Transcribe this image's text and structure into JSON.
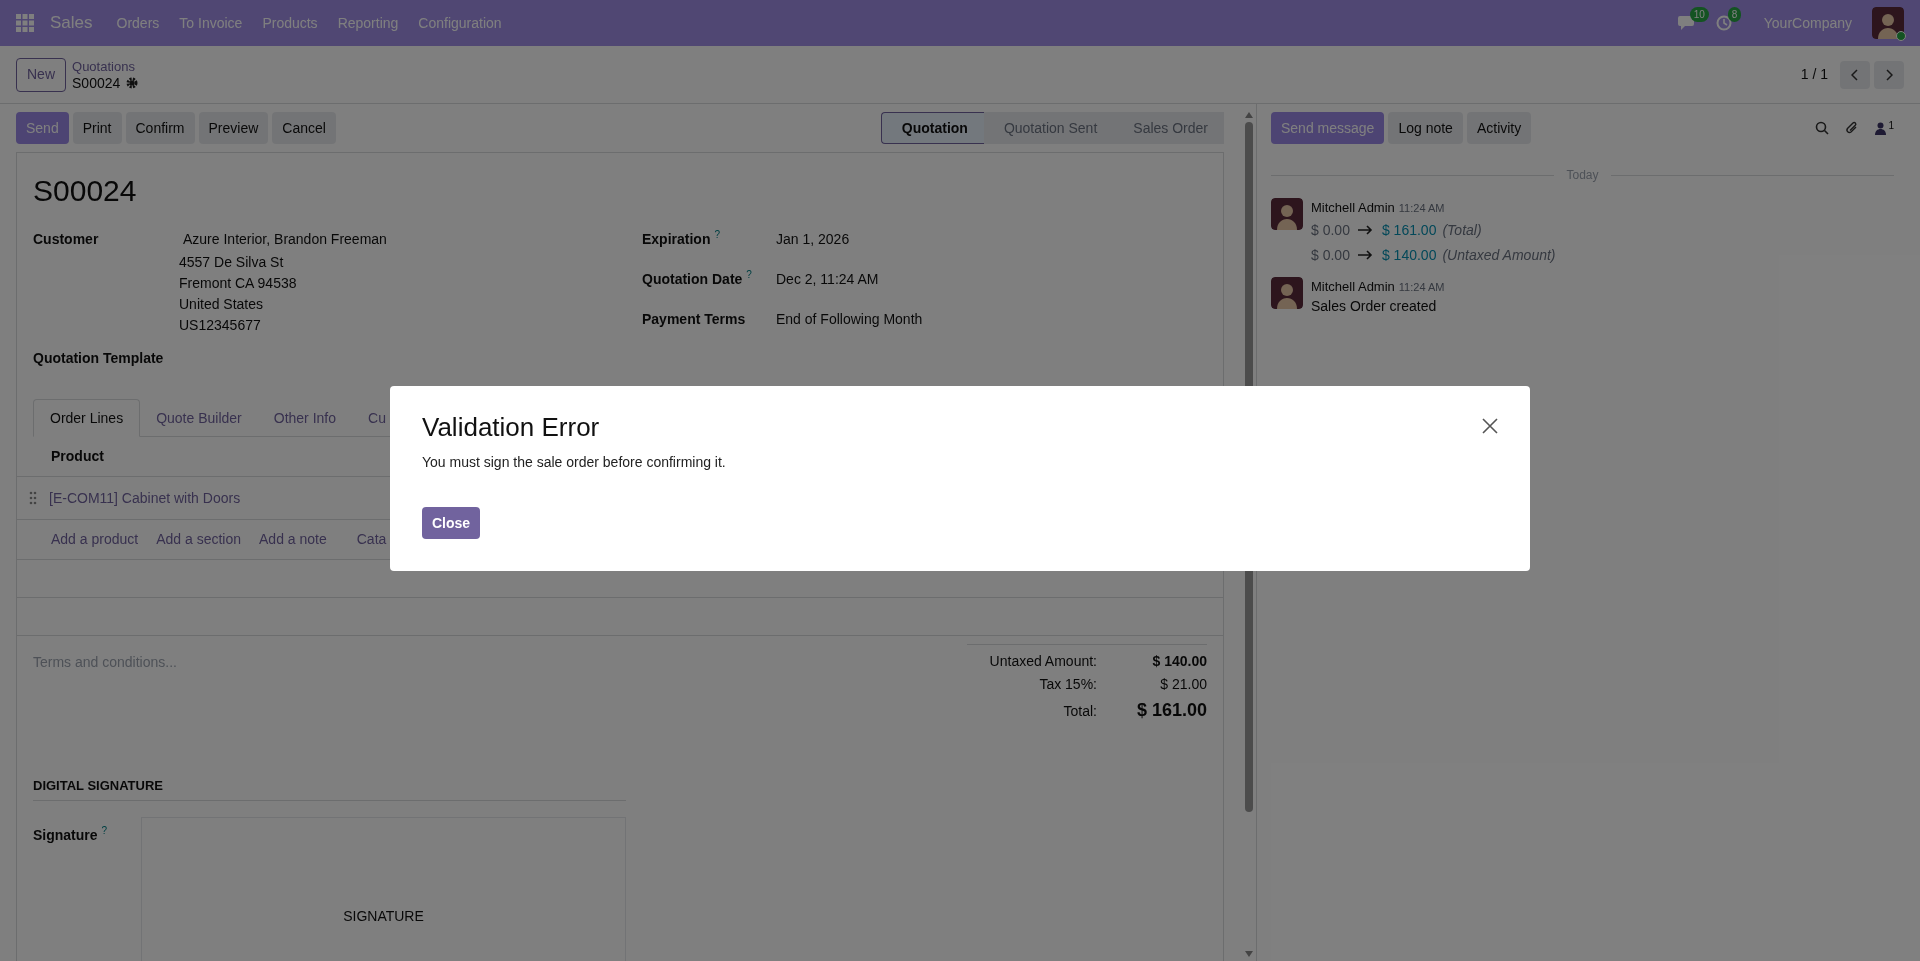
{
  "navbar": {
    "app_name": "Sales",
    "menu": [
      "Orders",
      "To Invoice",
      "Products",
      "Reporting",
      "Configuration"
    ],
    "messages_badge": "10",
    "activities_badge": "8",
    "company": "YourCompany"
  },
  "control_panel": {
    "new_button": "New",
    "breadcrumb": "Quotations",
    "record": "S00024",
    "pager": "1 / 1"
  },
  "actions": [
    {
      "label": "Send",
      "kind": "primary"
    },
    {
      "label": "Print",
      "kind": "secondary"
    },
    {
      "label": "Confirm",
      "kind": "secondary"
    },
    {
      "label": "Preview",
      "kind": "secondary"
    },
    {
      "label": "Cancel",
      "kind": "secondary"
    }
  ],
  "statusbar": [
    {
      "label": "Quotation",
      "selected": true
    },
    {
      "label": "Quotation Sent",
      "selected": false
    },
    {
      "label": "Sales Order",
      "selected": false
    }
  ],
  "form": {
    "title": "S00024",
    "customer": {
      "label": "Customer",
      "lines": [
        "Azure Interior, Brandon Freeman",
        "4557 De Silva St",
        "Fremont CA 94538",
        "United States",
        "US12345677"
      ]
    },
    "right_fields": [
      {
        "label": "Expiration",
        "help": "?",
        "value": "Jan 1, 2026"
      },
      {
        "label": "Quotation Date",
        "help": "?",
        "value": "Dec 2, 11:24 AM"
      },
      {
        "label": "Payment Terms",
        "value": "End of Following Month"
      }
    ],
    "template_label": "Quotation Template",
    "tabs": [
      {
        "label": "Order Lines",
        "selected": true
      },
      {
        "label": "Quote Builder",
        "selected": false
      },
      {
        "label": "Other Info",
        "selected": false
      },
      {
        "label": "Cu",
        "selected": false
      }
    ],
    "order_lines": {
      "column": "Product",
      "rows": [
        "[E-COM11] Cabinet with Doors"
      ],
      "add_links": [
        "Add a product",
        "Add a section",
        "Add a note",
        "Cata"
      ]
    },
    "terms_placeholder": "Terms and conditions...",
    "totals": [
      {
        "label": "Untaxed Amount:",
        "value": "$ 140.00",
        "kind": "subtotal"
      },
      {
        "label": "Tax 15%:",
        "value": "$ 21.00",
        "kind": "tax"
      },
      {
        "label": "Total:",
        "value": "$ 161.00",
        "kind": "total"
      }
    ],
    "signature_section": {
      "heading": "DIGITAL SIGNATURE",
      "label": "Signature",
      "help": "?",
      "box_text": "SIGNATURE"
    }
  },
  "chatter": {
    "buttons": [
      {
        "label": "Send message",
        "kind": "primary"
      },
      {
        "label": "Log note",
        "kind": "secondary"
      },
      {
        "label": "Activity",
        "kind": "secondary"
      }
    ],
    "followers": "1",
    "date_divider": "Today",
    "messages": [
      {
        "author": "Mitchell Admin",
        "time": "11:24 AM",
        "changes": [
          {
            "old": "$ 0.00",
            "new": "$ 161.00",
            "field": "(Total)"
          },
          {
            "old": "$ 0.00",
            "new": "$ 140.00",
            "field": "(Untaxed Amount)"
          }
        ]
      },
      {
        "author": "Mitchell Admin",
        "time": "11:24 AM",
        "body": "Sales Order created"
      }
    ]
  },
  "dialog": {
    "title": "Validation Error",
    "body": "You must sign the sale order before confirming it.",
    "button": "Close"
  }
}
